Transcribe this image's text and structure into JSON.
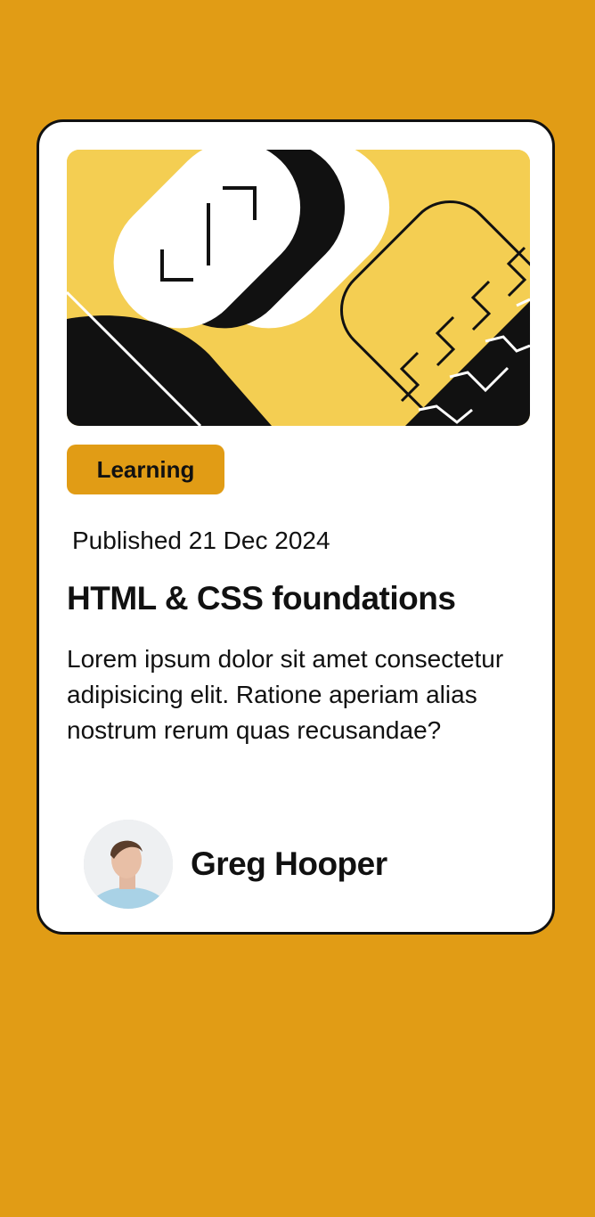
{
  "colors": {
    "page_background": "#E19C15",
    "card_background": "#FFFFFF",
    "card_border": "#111111",
    "badge_background": "#E19C15",
    "illustration_yellow": "#F4CE52",
    "text": "#111111"
  },
  "card": {
    "hero_image": "abstract-geometric-illustration",
    "badge": "Learning",
    "date": "Published 21 Dec 2024",
    "title": "HTML & CSS foundations",
    "description": "Lorem ipsum dolor sit amet consectetur adipisicing elit. Ratione aperiam alias nostrum rerum quas recusandae?",
    "author": {
      "avatar": "author-avatar-photo",
      "name": "Greg Hooper"
    }
  }
}
